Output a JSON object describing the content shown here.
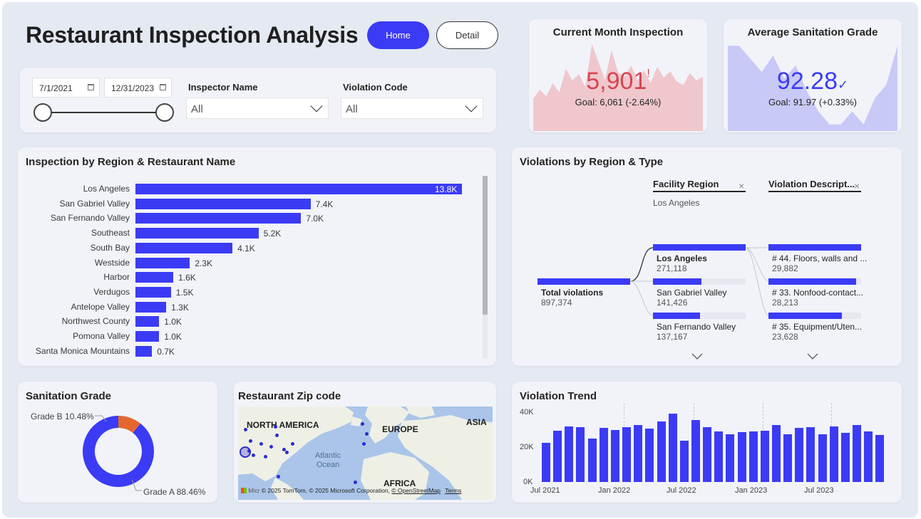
{
  "header": {
    "title": "Restaurant Inspection Analysis",
    "home_label": "Home",
    "detail_label": "Detail"
  },
  "kpi_current": {
    "title": "Current Month Inspection",
    "value": "5,901",
    "alert": "!",
    "goal": "Goal: 6,061 (-2.64%)",
    "value_color": "#d64550"
  },
  "kpi_grade": {
    "title": "Average Sanitation Grade",
    "value": "92.28",
    "check": "✓",
    "goal": "Goal: 91.97 (+0.33%)",
    "value_color": "#3b3bf5"
  },
  "filters": {
    "date_start": "7/1/2021",
    "date_end": "12/31/2023",
    "inspector_label": "Inspector Name",
    "inspector_value": "All",
    "violation_label": "Violation Code",
    "violation_value": "All"
  },
  "region_chart": {
    "title": "Inspection by Region & Restaurant Name",
    "categories": [
      "Los Angeles",
      "San Gabriel Valley",
      "San Fernando Valley",
      "Southeast",
      "South Bay",
      "Westside",
      "Harbor",
      "Verdugos",
      "Antelope Valley",
      "Northwest County",
      "Pomona Valley",
      "Santa Monica Mountains"
    ],
    "labels": [
      "13.8K",
      "7.4K",
      "7.0K",
      "5.2K",
      "4.1K",
      "2.3K",
      "1.6K",
      "1.5K",
      "1.3K",
      "1.0K",
      "1.0K",
      "0.7K"
    ]
  },
  "decomp": {
    "title": "Violations by Region & Type",
    "col1_header": "Facility Region",
    "col1_filter": "Los Angeles",
    "col2_header": "Violation Descript...",
    "close_symbol": "×",
    "total_label": "Total violations",
    "total_value": "897,374",
    "regions": [
      {
        "name": "Los Angeles",
        "value": "271,118"
      },
      {
        "name": "San Gabriel Valley",
        "value": "141,426"
      },
      {
        "name": "San Fernando Valley",
        "value": "137,167"
      }
    ],
    "types": [
      {
        "name": "# 44. Floors, walls and ...",
        "value": "29,882"
      },
      {
        "name": "# 33. Nonfood-contact...",
        "value": "28,213"
      },
      {
        "name": "# 35. Equipment/Uten...",
        "value": "23,628"
      }
    ]
  },
  "sanitation": {
    "title": "Sanitation Grade",
    "grade_b_label": "Grade B 10.48%",
    "grade_a_label": "Grade A 88.46%",
    "color_a": "#3b3bf5",
    "color_b": "#e4682c"
  },
  "map": {
    "title": "Restaurant Zip code",
    "north_america": "NORTH AMERICA",
    "europe": "EUROPE",
    "asia": "ASIA",
    "africa": "AFRICA",
    "ocean_line1": "Atlantic",
    "ocean_line2": "Ocean",
    "copyright": "© 2025 TomTom, © 2025 Microsoft Corporation,",
    "osm": "© OpenStreetMap",
    "terms": "Terms",
    "ms_logo_text": "Micr"
  },
  "trend": {
    "title": "Violation Trend",
    "y_ticks": [
      "40K",
      "20K",
      "0K"
    ],
    "x_ticks": [
      "Jul 2021",
      "Jan 2022",
      "Jul 2022",
      "Jan 2023",
      "Jul 2023"
    ]
  },
  "chart_data": [
    {
      "type": "bar",
      "title": "Inspection by Region & Restaurant Name",
      "orientation": "horizontal",
      "categories": [
        "Los Angeles",
        "San Gabriel Valley",
        "San Fernando Valley",
        "Southeast",
        "South Bay",
        "Westside",
        "Harbor",
        "Verdugos",
        "Antelope Valley",
        "Northwest County",
        "Pomona Valley",
        "Santa Monica Mountains"
      ],
      "values": [
        13.8,
        7.4,
        7.0,
        5.2,
        4.1,
        2.3,
        1.6,
        1.5,
        1.3,
        1.0,
        1.0,
        0.7
      ],
      "unit": "K"
    },
    {
      "type": "pie",
      "title": "Sanitation Grade",
      "categories": [
        "Grade A",
        "Grade B"
      ],
      "values": [
        88.46,
        10.48
      ]
    },
    {
      "type": "bar",
      "title": "Violation Trend",
      "x": [
        "Jul 2021",
        "Aug 2021",
        "Sep 2021",
        "Oct 2021",
        "Nov 2021",
        "Dec 2021",
        "Jan 2022",
        "Feb 2022",
        "Mar 2022",
        "Apr 2022",
        "May 2022",
        "Jun 2022",
        "Jul 2022",
        "Aug 2022",
        "Sep 2022",
        "Oct 2022",
        "Nov 2022",
        "Dec 2022",
        "Jan 2023",
        "Feb 2023",
        "Mar 2023",
        "Apr 2023",
        "May 2023",
        "Jun 2023",
        "Jul 2023",
        "Aug 2023",
        "Sep 2023",
        "Oct 2023",
        "Nov 2023",
        "Dec 2023"
      ],
      "values": [
        22500,
        29500,
        32000,
        31500,
        25000,
        31000,
        30000,
        31500,
        32500,
        30500,
        34500,
        39000,
        23500,
        35500,
        31500,
        29000,
        27500,
        28500,
        29000,
        29500,
        32500,
        27500,
        31000,
        31500,
        27500,
        32000,
        28000,
        32500,
        29000,
        27000
      ],
      "ylim": [
        0,
        40000
      ]
    },
    {
      "type": "area",
      "title": "Current Month Inspection",
      "values": [
        3.5,
        4.5,
        3.8,
        5.2,
        4.2,
        6.8,
        5.5,
        6.2,
        4.8,
        9.5,
        7.5,
        5.6,
        8.8,
        6.4,
        5.9,
        7.1,
        5.5,
        6.6,
        5.2,
        7.0,
        5.8,
        6.5,
        5.4,
        5.0,
        6.3,
        5.5,
        5.9
      ]
    },
    {
      "type": "area",
      "title": "Average Sanitation Grade",
      "values": [
        97,
        97,
        95,
        93,
        95.5,
        92,
        94,
        90,
        87,
        85,
        85,
        87,
        85,
        89,
        91,
        97
      ]
    }
  ]
}
